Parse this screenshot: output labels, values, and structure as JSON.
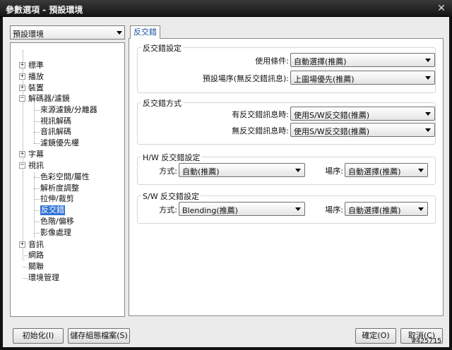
{
  "window": {
    "title": "參數選項 - 預設環境",
    "close_label": "✕"
  },
  "profile": {
    "selected": "預設環境"
  },
  "tree": {
    "items": [
      {
        "label": "標準",
        "expander": "+"
      },
      {
        "label": "播放",
        "expander": "+"
      },
      {
        "label": "裝置",
        "expander": "+"
      },
      {
        "label": "解碼器/濾鏡",
        "expander": "−"
      },
      {
        "label": "來源濾鏡/分離器"
      },
      {
        "label": "視訊解碼"
      },
      {
        "label": "音訊解碼"
      },
      {
        "label": "濾鏡優先權"
      },
      {
        "label": "字幕",
        "expander": "+"
      },
      {
        "label": "視訊",
        "expander": "−"
      },
      {
        "label": "色彩空間/屬性"
      },
      {
        "label": "解析度調整"
      },
      {
        "label": "拉伸/裁剪"
      },
      {
        "label": "反交錯"
      },
      {
        "label": "色階/偏移"
      },
      {
        "label": "影像處理"
      },
      {
        "label": "音訊",
        "expander": "+"
      },
      {
        "label": "網路"
      },
      {
        "label": "關聯"
      },
      {
        "label": "環境管理"
      }
    ]
  },
  "tab": {
    "label": "反交錯"
  },
  "groups": {
    "deint_settings": {
      "title": "反交錯設定",
      "use_condition_label": "使用條件:",
      "use_condition_value": "自動選擇(推薦)",
      "field_order_label": "預設場序(無反交錯訊息):",
      "field_order_value": "上圖場優先(推薦)"
    },
    "deint_method": {
      "title": "反交錯方式",
      "with_info_label": "有反交錯訊息時:",
      "with_info_value": "使用S/W反交錯(推薦)",
      "without_info_label": "無反交錯訊息時:",
      "without_info_value": "使用S/W反交錯(推薦)"
    },
    "hw": {
      "title": "H/W 反交錯設定",
      "method_label": "方式:",
      "method_value": "自動(推薦)",
      "field_label": "場序:",
      "field_value": "自動選擇(推薦)"
    },
    "sw": {
      "title": "S/W 反交錯設定",
      "method_label": "方式:",
      "method_value": "Blending(推薦)",
      "field_label": "場序:",
      "field_value": "自動選擇(推薦)"
    }
  },
  "buttons": {
    "init": "初始化(I)",
    "save": "儲存組態檔案(S)",
    "ok": "確定(O)",
    "cancel": "取消(C)"
  },
  "watermark": "#425715"
}
